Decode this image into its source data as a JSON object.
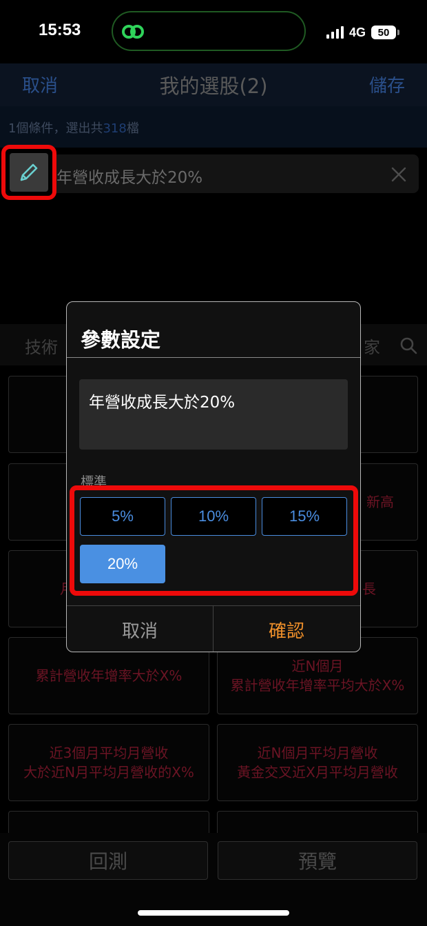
{
  "status_bar": {
    "time": "15:53",
    "network": "4G",
    "battery": "50"
  },
  "header": {
    "cancel_label": "取消",
    "title": "我的選股(2)",
    "save_label": "儲存"
  },
  "summary": {
    "prefix": "1個條件，選出共",
    "count": "318",
    "suffix": "檔"
  },
  "condition": {
    "text": "年營收成長大於20%"
  },
  "category_tabs": {
    "left": "技術",
    "right": "家"
  },
  "grid_cards": [
    "",
    "",
    "",
    "新高",
    "月",
    "長",
    "累計營收年增率大於X%",
    "近N個月\n累計營收年增率平均大於X%",
    "近3個月平均月營收\n大於近N月平均月營收的X%",
    "近N個月平均月營收\n黃金交叉近X月平均月營收"
  ],
  "bottom_bar": {
    "backtest_label": "回測",
    "preview_label": "預覽"
  },
  "modal": {
    "title": "參數設定",
    "condition_text": "年營收成長大於20%",
    "criteria_label": "標準",
    "options": [
      "5%",
      "10%",
      "15%",
      "20%"
    ],
    "selected_option": "20%",
    "cancel_label": "取消",
    "confirm_label": "確認"
  },
  "colors": {
    "accent_blue": "#4a90e2",
    "highlight_red": "#ee0a0a",
    "confirm_orange": "#f0902a"
  }
}
